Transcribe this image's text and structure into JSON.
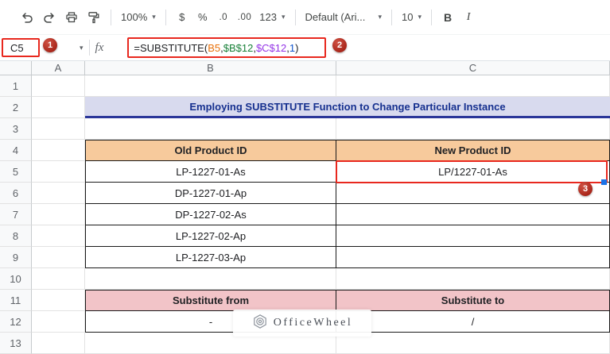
{
  "toolbar": {
    "zoom": "100%",
    "currency": "$",
    "percent": "%",
    "decrease_decimal": ".0",
    "increase_decimal": ".00",
    "more_formats": "123",
    "font_name": "Default (Ari...",
    "font_size": "10",
    "bold": "B",
    "italic": "I"
  },
  "formula_bar": {
    "name_box": "C5",
    "fx": "fx",
    "formula": {
      "fn": "=SUBSTITUTE(",
      "arg1": "B5",
      "c1": ",",
      "arg2": "$B$12",
      "c2": ",",
      "arg3": "$C$12",
      "c3": ",",
      "arg4": "1",
      "close": ")"
    }
  },
  "annotations": {
    "badge_1": "1",
    "badge_2": "2",
    "badge_3": "3"
  },
  "sheet": {
    "column_headers": [
      "A",
      "B",
      "C"
    ],
    "row_headers": [
      "1",
      "2",
      "3",
      "4",
      "5",
      "6",
      "7",
      "8",
      "9",
      "10",
      "11",
      "12",
      "13"
    ],
    "title": "Employing SUBSTITUTE Function to Change Particular Instance",
    "product_table": {
      "headers": [
        "Old Product ID",
        "New Product ID"
      ],
      "rows": [
        [
          "LP-1227-01-As",
          "LP/1227-01-As"
        ],
        [
          "DP-1227-01-Ap",
          ""
        ],
        [
          "DP-1227-02-As",
          ""
        ],
        [
          "LP-1227-02-Ap",
          ""
        ],
        [
          "LP-1227-03-Ap",
          ""
        ]
      ]
    },
    "substitute_table": {
      "headers": [
        "Substitute from",
        "Substitute to"
      ],
      "rows": [
        [
          "-",
          "/"
        ]
      ]
    }
  },
  "watermark": {
    "text": "OfficeWheel"
  },
  "icons": {
    "dropdown": "▾"
  },
  "colors": {
    "annotation_red": "#e8281e",
    "badge_red": "#991409",
    "title_bg": "#d8daee",
    "title_text": "#16308f",
    "title_underline": "#2b3699",
    "product_header_bg": "#f7ca9c",
    "substitute_header_bg": "#f2c4c8",
    "formula_ref1": "#e8710a",
    "formula_ref2": "#188038",
    "formula_ref3": "#9334e6",
    "formula_num": "#1155cc",
    "active_cell_blue": "#1a73e8"
  }
}
